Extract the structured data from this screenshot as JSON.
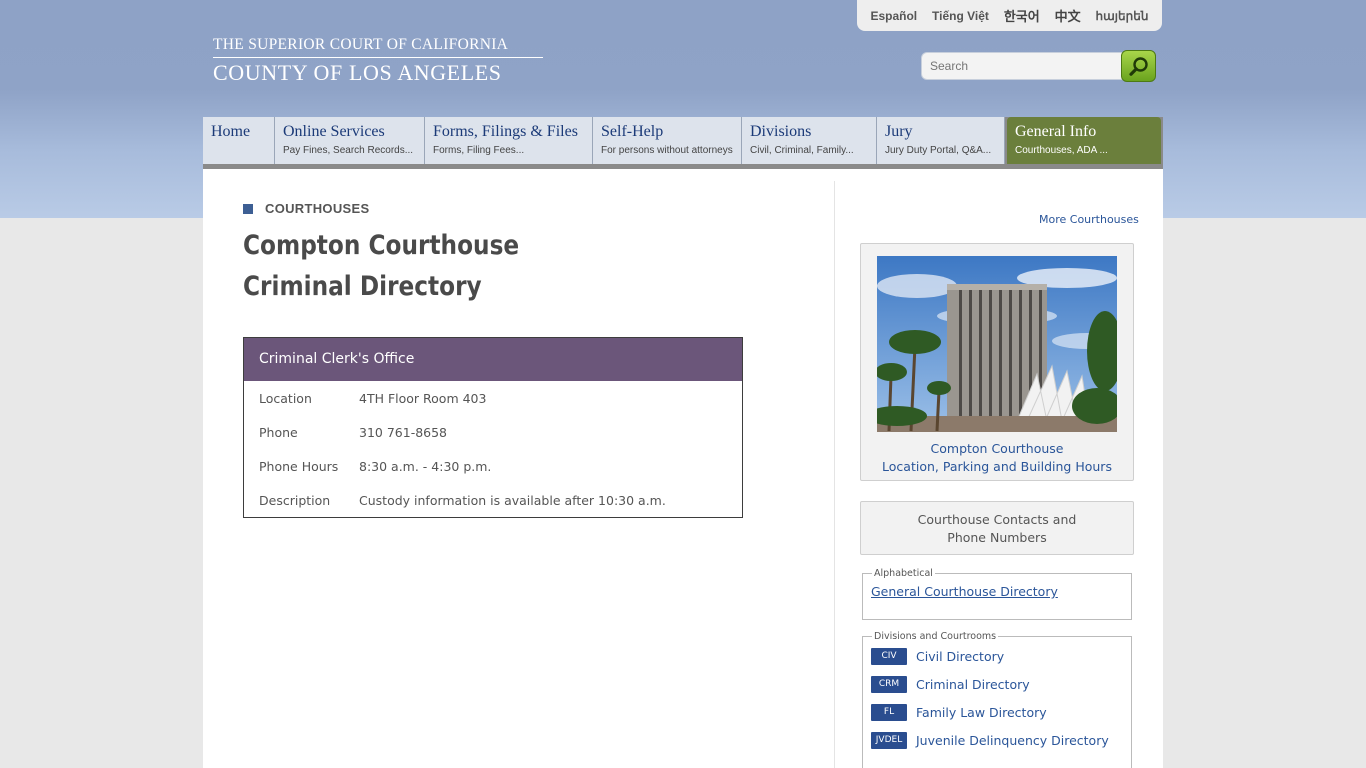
{
  "languages": [
    "Español",
    "Tiếng Việt",
    "한국어",
    "中文",
    "հայերեն"
  ],
  "logo": {
    "line1": "THE SUPERIOR COURT OF CALIFORNIA",
    "line2": "COUNTY OF LOS ANGELES"
  },
  "search": {
    "placeholder": "Search"
  },
  "nav": [
    {
      "title": "Home",
      "sub": ""
    },
    {
      "title": "Online Services",
      "sub": "Pay Fines, Search Records..."
    },
    {
      "title": "Forms, Filings & Files",
      "sub": "Forms, Filing Fees..."
    },
    {
      "title": "Self-Help",
      "sub": "For persons without attorneys"
    },
    {
      "title": "Divisions",
      "sub": "Civil, Criminal, Family..."
    },
    {
      "title": "Jury",
      "sub": "Jury Duty Portal, Q&A..."
    },
    {
      "title": "General Info",
      "sub": "Courthouses, ADA ..."
    }
  ],
  "section_label": "COURTHOUSES",
  "page_title": {
    "line1": "Compton Courthouse",
    "line2": "Criminal Directory"
  },
  "clerk": {
    "heading": "Criminal Clerk's Office",
    "rows": [
      {
        "key": "Location",
        "value": "4TH Floor Room 403"
      },
      {
        "key": "Phone",
        "value": "310 761-8658"
      },
      {
        "key": "Phone Hours",
        "value": "8:30 a.m. - 4:30 p.m."
      },
      {
        "key": "Description",
        "value": "Custody information is available after 10:30 a.m."
      }
    ]
  },
  "sidebar": {
    "more_link": "More Courthouses",
    "photo_caption_line1": "Compton Courthouse",
    "photo_caption_line2": "Location, Parking and Building Hours",
    "contacts_line1": "Courthouse Contacts and",
    "contacts_line2": "Phone Numbers",
    "alphabetical_legend": "Alphabetical",
    "alphabetical_link": "General Courthouse Directory",
    "divisions_legend": "Divisions and Courtrooms",
    "directories": [
      {
        "badge": "CIV",
        "label": "Civil Directory"
      },
      {
        "badge": "CRM",
        "label": "Criminal Directory"
      },
      {
        "badge": "FL",
        "label": "Family Law Directory"
      },
      {
        "badge": "JVDEL",
        "label": "Juvenile Delinquency Directory"
      }
    ]
  },
  "colors": {
    "nav_active": "#6b7f3c",
    "clerk_header": "#6b567a",
    "link": "#2a5599",
    "badge": "#2a4d8f"
  }
}
